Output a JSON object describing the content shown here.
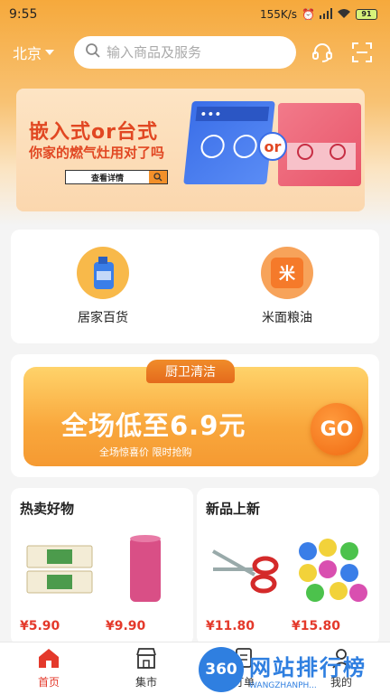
{
  "status_bar": {
    "time": "9:55",
    "network_speed": "155K/s",
    "battery": "91"
  },
  "header": {
    "city": "北京",
    "search_placeholder": "输入商品及服务",
    "icons": [
      "search-icon",
      "headset-icon",
      "scan-icon"
    ]
  },
  "banner": {
    "title": "嵌入式or台式",
    "subtitle": "你家的燃气灶用对了吗",
    "button_label": "查看详情",
    "badge_text": "or"
  },
  "categories": [
    {
      "label": "居家百货",
      "icon": "detergent-bottle-icon"
    },
    {
      "label": "米面粮油",
      "icon": "rice-bag-icon",
      "icon_text": "米"
    }
  ],
  "promo": {
    "tag": "厨卫清洁",
    "headline": "全场低至6.9元",
    "subline": "全场惊喜价  限时抢购",
    "go_label": "GO"
  },
  "sections": [
    {
      "title": "热卖好物",
      "products": [
        {
          "image": "noodle-pack-image",
          "price": "¥5.90"
        },
        {
          "image": "pink-roll-image",
          "price": "¥9.90"
        }
      ]
    },
    {
      "title": "新品上新",
      "products": [
        {
          "image": "scissors-image",
          "price": "¥11.80"
        },
        {
          "image": "trash-bags-image",
          "price": "¥15.80"
        }
      ]
    }
  ],
  "bottom_nav": {
    "items": [
      {
        "label": "首页",
        "icon": "home-icon",
        "active": true
      },
      {
        "label": "集市",
        "icon": "market-icon",
        "active": false
      },
      {
        "label": "订单",
        "icon": "order-icon",
        "active": false
      },
      {
        "label": "我的",
        "icon": "profile-icon",
        "active": false
      }
    ]
  },
  "watermark": {
    "badge": "360",
    "text": "网站排行榜",
    "url": "WANGZHANPH..."
  },
  "colors": {
    "accent": "#f6a93c",
    "price_red": "#e4392b",
    "watermark_blue": "#2f7fe0"
  }
}
